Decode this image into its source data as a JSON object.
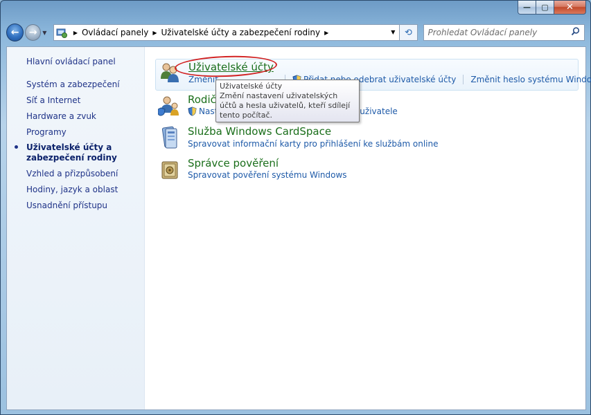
{
  "window": {
    "caption": {
      "minimize": "—",
      "maximize": "▢",
      "close": "✕"
    }
  },
  "navigation": {
    "breadcrumbs": [
      "Ovládací panely",
      "Uživatelské účty a zabezpečení rodiny"
    ],
    "search_placeholder": "Prohledat Ovládací panely"
  },
  "sidebar": {
    "home": "Hlavní ovládací panel",
    "items": [
      "Systém a zabezpečení",
      "Síť a Internet",
      "Hardware a zvuk",
      "Programy",
      "Uživatelské účty a zabezpečení rodiny",
      "Vzhled a přizpůsobení",
      "Hodiny, jazyk a oblast",
      "Usnadnění přístupu"
    ],
    "active_index": 4
  },
  "categories": [
    {
      "title": "Uživatelské účty",
      "links": [
        "Změnit",
        "Přidat nebo odebrat uživatelské účty",
        "Změnit heslo systému Windows"
      ]
    },
    {
      "title": "Rodič",
      "links": [
        "Nast",
        "uživatele"
      ]
    },
    {
      "title": "Služba Windows CardSpace",
      "links": [
        "Spravovat informační karty pro přihlášení ke službám online"
      ]
    },
    {
      "title": "Správce pověření",
      "links": [
        "Spravovat pověření systému Windows"
      ]
    }
  ],
  "tooltip": {
    "title": "Uživatelské účty",
    "body": "Změní nastavení uživatelských účtů a hesla uživatelů, kteří sdílejí tento počítač."
  },
  "colors": {
    "category_title": "#1a6e1a",
    "link": "#1e5aa8",
    "annotation": "#d22323"
  }
}
